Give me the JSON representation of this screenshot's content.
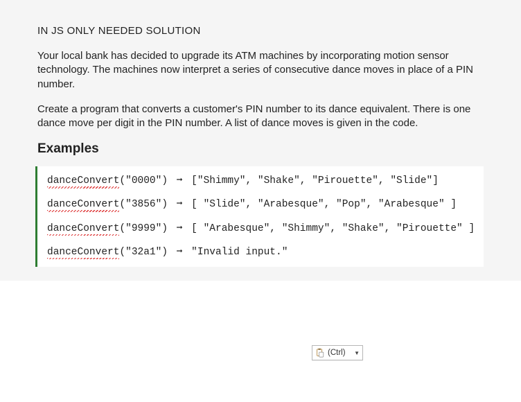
{
  "title": "IN JS ONLY NEEDED SOLUTION",
  "para1": "Your local bank has decided to upgrade its ATM machines by incorporating motion sensor technology. The machines now interpret a series of consecutive dance moves in place of a PIN number.",
  "para2": "Create a program that converts a customer's PIN number to its dance equivalent. There is one dance move per digit in the PIN number. A list of dance moves is given in the code.",
  "heading": "Examples",
  "code": {
    "fn": "danceConvert",
    "arrow": "➞",
    "ex1_arg": "(\"0000\")",
    "ex1_out": " [\"Shimmy\", \"Shake\", \"Pirouette\", \"Slide\"]",
    "ex2_arg": "(\"3856\")",
    "ex2_out": " [ \"Slide\", \"Arabesque\", \"Pop\", \"Arabesque\" ]",
    "ex3_arg": "(\"9999\")",
    "ex3_out": " [ \"Arabesque\", \"Shimmy\", \"Shake\", \"Pirouette\" ]",
    "ex4_arg": "(\"32a1\")",
    "ex4_out": " \"Invalid input.\""
  },
  "paste": {
    "label": "(Ctrl)"
  }
}
